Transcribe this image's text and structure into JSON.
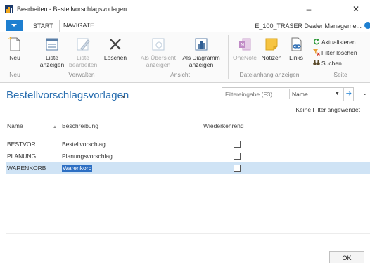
{
  "window": {
    "title": "Bearbeiten - Bestellvorschlagsvorlagen",
    "minimize": "–",
    "maximize": "☐",
    "close": "✕"
  },
  "tabs": [
    {
      "label": "START",
      "active": true
    },
    {
      "label": "NAVIGATE",
      "active": false
    }
  ],
  "company": "E_100_TRASER Dealer Manageme...",
  "ribbon": {
    "neu": {
      "label": "Neu",
      "group": "Neu"
    },
    "verwalten": {
      "group": "Verwalten",
      "liste_anzeigen": [
        "Liste",
        "anzeigen"
      ],
      "liste_bearbeiten": [
        "Liste",
        "bearbeiten"
      ],
      "loeschen": "Löschen"
    },
    "ansicht": {
      "group": "Ansicht",
      "uebersicht": [
        "Als Übersicht",
        "anzeigen"
      ],
      "diagramm": [
        "Als Diagramm",
        "anzeigen"
      ]
    },
    "dateianhang": {
      "group": "Dateianhang anzeigen",
      "onenote": "OneNote",
      "notizen": "Notizen",
      "links": "Links"
    },
    "seite": {
      "group": "Seite",
      "aktualisieren": "Aktualisieren",
      "filter_loeschen": "Filter löschen",
      "suchen": "Suchen"
    }
  },
  "page": {
    "title": "Bestellvorschlagsvorlagen",
    "filter_placeholder": "Filtereingabe (F3)",
    "filter_field": "Name",
    "no_filter": "Keine Filter angewendet"
  },
  "table": {
    "headers": {
      "name": "Name",
      "beschreibung": "Beschreibung",
      "wiederkehrend": "Wiederkehrend"
    },
    "rows": [
      {
        "name": "BESTVOR",
        "beschreibung": "Bestellvorschlag",
        "wiederkehrend": false,
        "selected": false
      },
      {
        "name": "PLANUNG",
        "beschreibung": "Planungsvorschlag",
        "wiederkehrend": false,
        "selected": false
      },
      {
        "name": "WARENKORB",
        "beschreibung": "Warenkorb",
        "wiederkehrend": false,
        "selected": true
      }
    ]
  },
  "ok_label": "OK",
  "colors": {
    "accent": "#1e7fd0",
    "title": "#2a6fb0",
    "selection": "#cfe3f5",
    "highlight": "#2d6fc3"
  }
}
